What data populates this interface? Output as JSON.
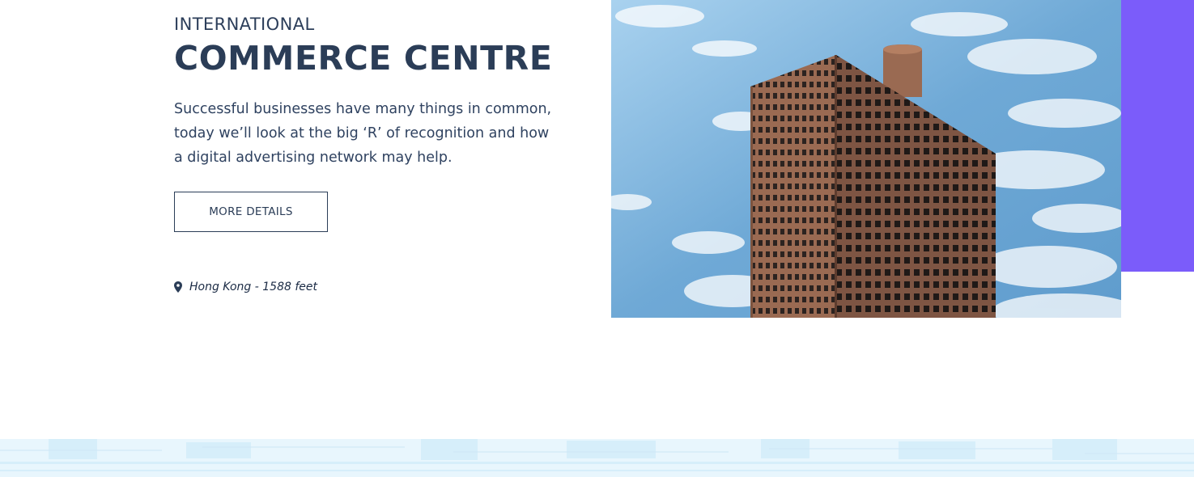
{
  "hero": {
    "subtitle": "INTERNATIONAL",
    "title": "COMMERCE CENTRE",
    "description": "Successful businesses have many things in common, today we’ll look at the big ‘R’ of recognition and how a digital advertising network may help.",
    "button_label": "MORE DETAILS",
    "location_icon": "map-pin-icon",
    "location_text": "Hong Kong - 1588 feet"
  },
  "colors": {
    "accent": "#7b5cfa",
    "heading": "#2b3d57",
    "sky": "#7fb6dc",
    "footer_tint": "#e8f6fd"
  }
}
